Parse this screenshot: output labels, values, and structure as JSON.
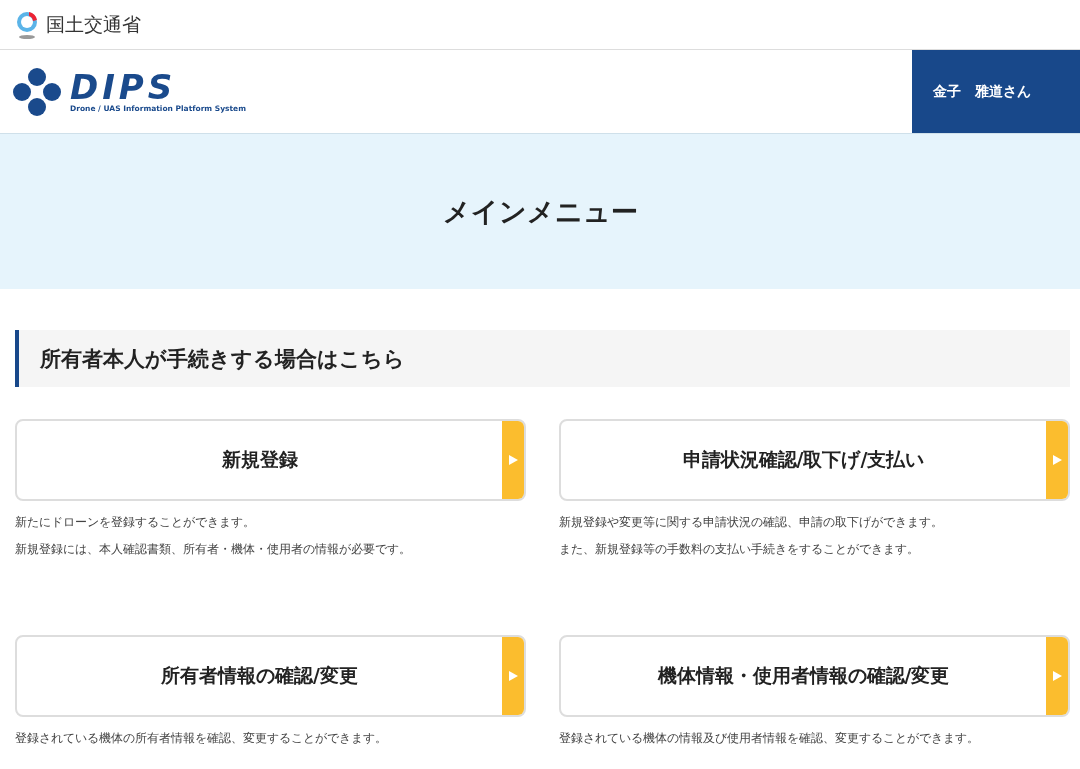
{
  "ministry": {
    "name": "国土交通省"
  },
  "logo": {
    "wordmark": "DIPS",
    "tagline": "Drone / UAS Information Platform System"
  },
  "user": {
    "name": "金子　雅道さん"
  },
  "page_title": "メインメニュー",
  "section": {
    "heading": "所有者本人が手続きする場合はこちら"
  },
  "menu_items": [
    {
      "label": "新規登録",
      "description": [
        "新たにドローンを登録することができます。",
        "新規登録には、本人確認書類、所有者・機体・使用者の情報が必要です。"
      ]
    },
    {
      "label": "申請状況確認/取下げ/支払い",
      "description": [
        "新規登録や変更等に関する申請状況の確認、申請の取下げができます。",
        "また、新規登録等の手数料の支払い手続きをすることができます。"
      ]
    },
    {
      "label": "所有者情報の確認/変更",
      "description": [
        "登録されている機体の所有者情報を確認、変更することができます。"
      ]
    },
    {
      "label": "機体情報・使用者情報の確認/変更",
      "description": [
        "登録されている機体の情報及び使用者情報を確認、変更することができます。"
      ]
    }
  ]
}
